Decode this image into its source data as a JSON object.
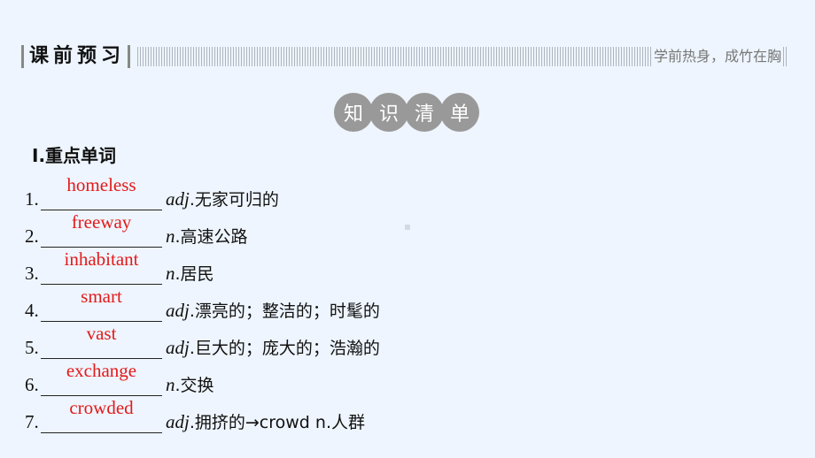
{
  "header": {
    "title": "课前预习",
    "subtitle": "学前热身，成竹在胸"
  },
  "badges": [
    "知",
    "识",
    "清",
    "单"
  ],
  "section": {
    "title": "Ⅰ.重点单词"
  },
  "items": [
    {
      "num": "1.",
      "answer": "homeless",
      "pos": "adj",
      "def": ".无家可归的"
    },
    {
      "num": "2.",
      "answer": "freeway",
      "pos": "n",
      "def": ".高速公路"
    },
    {
      "num": "3.",
      "answer": "inhabitant",
      "pos": "n",
      "def": ".居民"
    },
    {
      "num": "4.",
      "answer": "smart",
      "pos": "adj",
      "def": ".漂亮的；整洁的；时髦的"
    },
    {
      "num": "5.",
      "answer": "vast",
      "pos": "adj",
      "def": ".巨大的；庞大的；浩瀚的"
    },
    {
      "num": "6.",
      "answer": "exchange",
      "pos": "n",
      "def": ".交换"
    },
    {
      "num": "7.",
      "answer": "crowded",
      "pos": "adj",
      "def": ".拥挤的→crowd n.人群"
    }
  ]
}
